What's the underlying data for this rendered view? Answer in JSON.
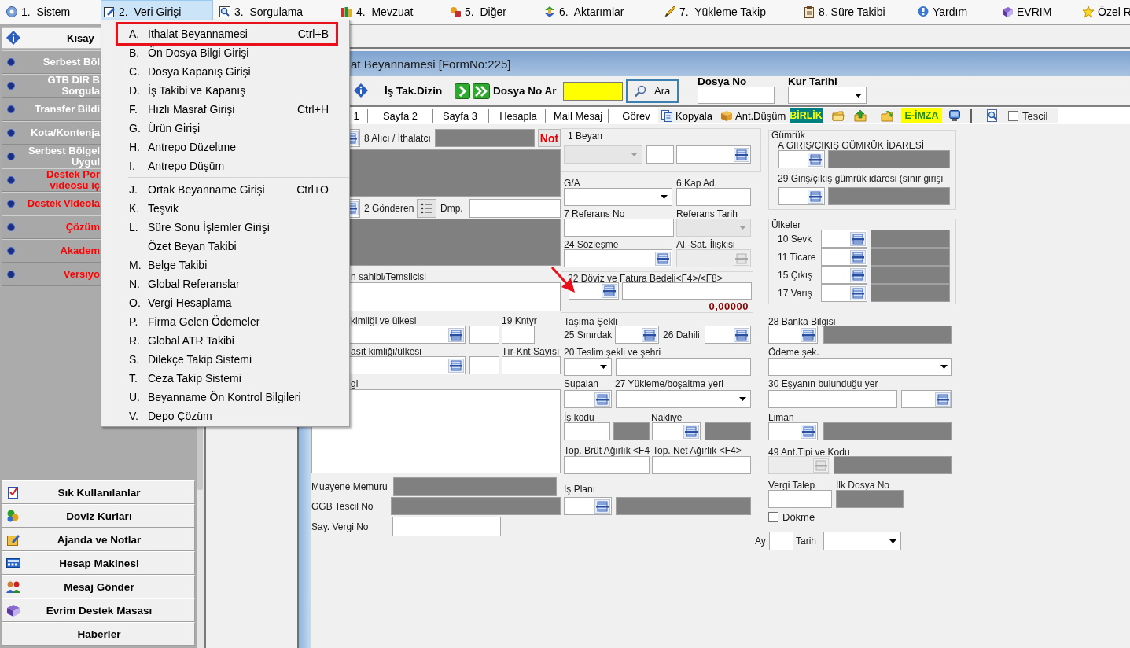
{
  "menu_bar": [
    {
      "label": "1.  Sistem",
      "selected": false
    },
    {
      "label": "2.  Veri Girişi",
      "selected": true
    },
    {
      "label": "3.  Sorgulama",
      "selected": false
    },
    {
      "label": "4.  Mevzuat",
      "selected": false
    },
    {
      "label": "5.  Diğer",
      "selected": false
    },
    {
      "label": "6.  Aktarımlar",
      "selected": false
    },
    {
      "label": "7.  Yükleme Takip",
      "selected": false
    },
    {
      "label": "8. Süre Takibi",
      "selected": false
    },
    {
      "label": "Yardım",
      "selected": false
    },
    {
      "label": "EVRIM",
      "selected": false
    },
    {
      "label": "Özel R",
      "selected": false
    }
  ],
  "dropdown": [
    {
      "kind": "item",
      "key": "A.",
      "label": "İthalat Beyannamesi",
      "shortcut": "Ctrl+B",
      "selected": true
    },
    {
      "kind": "item",
      "key": "B.",
      "label": "Ön Dosya Bilgi Girişi",
      "selected": false
    },
    {
      "kind": "item",
      "key": "C.",
      "label": "Dosya Kapanış Girişi",
      "selected": false
    },
    {
      "kind": "item",
      "key": "D.",
      "label": "İş Takibi ve Kapanış",
      "selected": false
    },
    {
      "kind": "item",
      "key": "F.",
      "label": "Hızlı Masraf Girişi",
      "shortcut": "Ctrl+H",
      "selected": false
    },
    {
      "kind": "item",
      "key": "G.",
      "label": "Ürün Girişi",
      "selected": false
    },
    {
      "kind": "item",
      "key": "H.",
      "label": "Antrepo Düzeltme",
      "selected": false
    },
    {
      "kind": "item",
      "key": "I.",
      "label": "Antrepo Düşüm",
      "selected": false
    },
    {
      "kind": "separator"
    },
    {
      "kind": "item",
      "key": "J.",
      "label": "Ortak Beyanname Girişi",
      "shortcut": "Ctrl+O",
      "selected": false
    },
    {
      "kind": "item",
      "key": "K.",
      "label": "Teşvik",
      "selected": false
    },
    {
      "kind": "item",
      "key": "L.",
      "label": "Süre Sonu İşlemler Girişi",
      "selected": false
    },
    {
      "kind": "item",
      "label": "Özet Beyan Takibi",
      "selected": false
    },
    {
      "kind": "item",
      "key": "M.",
      "label": "Belge Takibi",
      "selected": false
    },
    {
      "kind": "item",
      "key": "N.",
      "label": "Global Referanslar",
      "selected": false
    },
    {
      "kind": "item",
      "key": "O.",
      "label": "Vergi Hesaplama",
      "selected": false
    },
    {
      "kind": "item",
      "key": "P.",
      "label": "Firma Gelen Ödemeler",
      "selected": false
    },
    {
      "kind": "item",
      "key": "R.",
      "label": "Global ATR Takibi",
      "selected": false
    },
    {
      "kind": "item",
      "key": "S.",
      "label": "Dilekçe Takip Sistemi",
      "selected": false
    },
    {
      "kind": "item",
      "key": "T.",
      "label": "Ceza Takip Sistemi",
      "selected": false
    },
    {
      "kind": "item",
      "key": "U.",
      "label": "Beyanname Ön Kontrol Bilgileri",
      "selected": false
    },
    {
      "kind": "item",
      "key": "V.",
      "label": "Depo Çözüm",
      "selected": false
    }
  ],
  "sidebar": {
    "header": "Kısay",
    "items": [
      {
        "label": "Serbest Böl",
        "color": "#ffffff"
      },
      {
        "label": "GTB DIR B\nSorgula",
        "color": "#ffffff"
      },
      {
        "label": "Transfer Bildi",
        "color": "#ffffff"
      },
      {
        "label": "Kota/Kontenja",
        "color": "#ffffff"
      },
      {
        "label": "Serbest Bölgel\nUygul",
        "color": "#ffffff"
      },
      {
        "label": "Destek Por\nvideosu iç",
        "color": "#ff0000"
      },
      {
        "label": "Destek Videola",
        "color": "#ff0000"
      },
      {
        "label": "Çözüm",
        "color": "#ff0000"
      },
      {
        "label": "Akadem",
        "color": "#ff0000"
      },
      {
        "label": "Versiyo",
        "color": "#ff0000"
      }
    ],
    "buttons": [
      "Sık Kullanılanlar",
      "Doviz Kurları",
      "Ajanda ve Notlar",
      "Hesap Makinesi",
      "Mesaj Gönder",
      "Evrim Destek Masası",
      "Haberler"
    ]
  },
  "form": {
    "title": "at Beyannamesi [FormNo:225]",
    "search_bar": {
      "folder_label": "İş Tak.Dizin",
      "search_label": "Dosya No Ar",
      "search_button": "Ara",
      "file_no_label": "Dosya No",
      "rate_date_label": "Kur Tarihi"
    },
    "tabs": [
      "1",
      "Sayfa 2",
      "Sayfa 3",
      "Hesapla",
      "Mail Mesaj",
      "Görev"
    ],
    "tools": [
      {
        "kind": "copy",
        "label": "Kopyala"
      },
      {
        "kind": "box",
        "label": "Ant.Düşüm"
      },
      {
        "kind": "badge",
        "label": "BİRLİK",
        "color": "#008080"
      },
      {
        "kind": "folder"
      },
      {
        "kind": "upload"
      },
      {
        "kind": "move"
      },
      {
        "kind": "badge",
        "label": "E-İMZA",
        "color": "#ffff00"
      },
      {
        "kind": "monitor"
      },
      {
        "kind": "divider"
      },
      {
        "kind": "preview"
      },
      {
        "kind": "checkbox",
        "label": "Tescil",
        "checked": false
      }
    ],
    "columns": [
      [
        [
          {
            "kind": "lookup",
            "disabled": false
          },
          {
            "kind": "label",
            "text": "8 Alıcı / İthalatcı"
          },
          {
            "kind": "shaded"
          },
          {
            "kind": "button",
            "text": "Not"
          }
        ],
        [
          {
            "kind": "shaded"
          }
        ],
        [
          {
            "kind": "lookup",
            "disabled": false
          },
          {
            "kind": "label",
            "text": "2 Gönderen"
          },
          {
            "kind": "list"
          },
          {
            "kind": "label",
            "text": "Dmp."
          },
          {
            "kind": "input",
            "disabled": false
          }
        ],
        [
          {
            "kind": "shaded"
          }
        ],
        [
          {
            "kind": "label",
            "text": "n sahibi/Temsilcisi"
          }
        ],
        [
          {
            "kind": "memo"
          }
        ],
        [
          {
            "kind": "label",
            "text": "kimliği ve ülkesi"
          },
          {
            "kind": "label",
            "text": "19 Kntyr"
          }
        ],
        [
          {
            "kind": "lookup",
            "disabled": false
          },
          {
            "kind": "input",
            "disabled": false
          },
          {
            "kind": "input",
            "disabled": false
          }
        ],
        [
          {
            "kind": "label",
            "text": "aşıt kimliği/ülkesi"
          },
          {
            "kind": "label",
            "text": "Tır-Knt Sayısı"
          }
        ],
        [
          {
            "kind": "lookup",
            "disabled": false
          },
          {
            "kind": "input",
            "disabled": false
          },
          {
            "kind": "input",
            "disabled": false
          }
        ],
        [
          {
            "kind": "label",
            "text": "gi"
          }
        ],
        [
          {
            "kind": "memo"
          }
        ],
        [
          {
            "kind": "label",
            "text": "Muayene Memuru"
          },
          {
            "kind": "shaded"
          }
        ],
        [
          {
            "kind": "label",
            "text": "GGB Tescil No"
          },
          {
            "kind": "shaded"
          }
        ],
        [
          {
            "kind": "label",
            "text": "Say. Vergi No"
          },
          {
            "kind": "input",
            "disabled": false
          }
        ]
      ],
      [
        [
          {
            "kind": "group",
            "legend": "1 Beyan",
            "rows": [
              [
                {
                  "kind": "dropdown",
                  "disabled": true
                },
                {
                  "kind": "input",
                  "disabled": false
                },
                {
                  "kind": "lookup",
                  "disabled": false
                }
              ]
            ]
          }
        ],
        [
          {
            "kind": "label",
            "text": "G/A"
          },
          {
            "kind": "label",
            "text": "6 Kap Ad."
          }
        ],
        [
          {
            "kind": "dropdown",
            "disabled": false
          },
          {
            "kind": "input",
            "disabled": false
          }
        ],
        [
          {
            "kind": "label",
            "text": "7 Referans No"
          },
          {
            "kind": "label",
            "text": "Referans Tarih"
          }
        ],
        [
          {
            "kind": "input",
            "disabled": false
          },
          {
            "kind": "dropdown",
            "disabled": true
          }
        ],
        [
          {
            "kind": "label",
            "text": "24 Sözleşme"
          },
          {
            "kind": "label",
            "text": "Al.-Sat. İlişkisi"
          }
        ],
        [
          {
            "kind": "lookup",
            "disabled": false
          },
          {
            "kind": "lookup",
            "disabled": true
          }
        ],
        [
          {
            "kind": "group",
            "legend": "22 Döviz ve Fatura Bedeli<F4>/<F8>",
            "rows": [
              [
                {
                  "kind": "lookup",
                  "disabled": false
                },
                {
                  "kind": "input",
                  "disabled": false
                }
              ],
              [
                {
                  "kind": "value",
                  "text": "0,00000"
                }
              ]
            ]
          }
        ],
        [
          {
            "kind": "label",
            "text": "Taşıma Şekli"
          }
        ],
        [
          {
            "kind": "label",
            "text": "25 Sınırdak"
          },
          {
            "kind": "lookup",
            "disabled": false
          },
          {
            "kind": "label",
            "text": "26 Dahili"
          },
          {
            "kind": "lookup",
            "disabled": false
          }
        ],
        [
          {
            "kind": "label",
            "text": "20 Teslim şekli ve şehri"
          }
        ],
        [
          {
            "kind": "dropdown",
            "disabled": false
          },
          {
            "kind": "input",
            "disabled": false
          }
        ],
        [
          {
            "kind": "label",
            "text": "Supalan"
          },
          {
            "kind": "label",
            "text": "27 Yükleme/boşaltma yeri"
          }
        ],
        [
          {
            "kind": "lookup",
            "disabled": false
          },
          {
            "kind": "dropdown",
            "disabled": false
          }
        ],
        [
          {
            "kind": "label",
            "text": "İş kodu"
          },
          {
            "kind": "label",
            "text": "Nakliye"
          }
        ],
        [
          {
            "kind": "input",
            "disabled": false
          },
          {
            "kind": "shaded"
          },
          {
            "kind": "lookup",
            "disabled": false
          },
          {
            "kind": "shaded"
          }
        ],
        [
          {
            "kind": "label",
            "text": "Top. Brüt Ağırlık <F4"
          },
          {
            "kind": "label",
            "text": "Top. Net Ağırlık <F4>"
          }
        ],
        [
          {
            "kind": "input",
            "disabled": false
          },
          {
            "kind": "input",
            "disabled": false
          }
        ],
        [
          {
            "kind": "label",
            "text": "İş Planı"
          }
        ],
        [
          {
            "kind": "lookup",
            "disabled": false
          },
          {
            "kind": "shaded"
          }
        ]
      ],
      [
        [
          {
            "kind": "group",
            "legend": "Gümrük",
            "rows": [
              [
                {
                  "kind": "label",
                  "text": "A GIRIŞ/ÇIKIŞ GÜMRÜK İDARESİ"
                }
              ],
              [
                {
                  "kind": "lookup",
                  "disabled": false
                },
                {
                  "kind": "shaded"
                }
              ],
              [
                {
                  "kind": "label",
                  "text": "29 Giriş/çıkış gümrük idaresi (sınır girişi"
                }
              ],
              [
                {
                  "kind": "lookup",
                  "disabled": false
                },
                {
                  "kind": "shaded"
                }
              ]
            ]
          }
        ],
        [
          {
            "kind": "group",
            "legend": "Ülkeler",
            "rows": [
              [
                {
                  "kind": "label",
                  "text": "10 Sevk"
                },
                {
                  "kind": "lookup",
                  "disabled": false
                },
                {
                  "kind": "shaded"
                }
              ],
              [
                {
                  "kind": "label",
                  "text": "11 Ticare"
                },
                {
                  "kind": "lookup",
                  "disabled": false
                },
                {
                  "kind": "shaded"
                }
              ],
              [
                {
                  "kind": "label",
                  "text": "15 Çıkış"
                },
                {
                  "kind": "lookup",
                  "disabled": false
                },
                {
                  "kind": "shaded"
                }
              ],
              [
                {
                  "kind": "label",
                  "text": "17 Varış"
                },
                {
                  "kind": "lookup",
                  "disabled": false
                },
                {
                  "kind": "shaded"
                }
              ]
            ]
          }
        ],
        [
          {
            "kind": "label",
            "text": "28 Banka Bilgisi"
          }
        ],
        [
          {
            "kind": "lookup",
            "disabled": false
          },
          {
            "kind": "shaded"
          }
        ],
        [
          {
            "kind": "label",
            "text": "Ödeme şek."
          }
        ],
        [
          {
            "kind": "dropdown",
            "disabled": false
          }
        ],
        [
          {
            "kind": "label",
            "text": "30 Eşyanın bulunduğu yer"
          }
        ],
        [
          {
            "kind": "input",
            "disabled": false
          },
          {
            "kind": "lookup",
            "disabled": false
          }
        ],
        [
          {
            "kind": "label",
            "text": "Liman"
          }
        ],
        [
          {
            "kind": "lookup",
            "disabled": false
          },
          {
            "kind": "shaded"
          }
        ],
        [
          {
            "kind": "label",
            "text": "49 Ant.Tipi ve Kodu"
          }
        ],
        [
          {
            "kind": "lookup",
            "disabled": true
          },
          {
            "kind": "shaded"
          }
        ],
        [
          {
            "kind": "label",
            "text": "Vergi Talep"
          },
          {
            "kind": "label",
            "text": "İlk Dosya No"
          }
        ],
        [
          {
            "kind": "input",
            "disabled": false
          },
          {
            "kind": "shaded"
          }
        ],
        [
          {
            "kind": "checkbox",
            "text": "Dökme",
            "checked": false
          }
        ],
        [
          {
            "kind": "label",
            "text": "Ay"
          },
          {
            "kind": "input",
            "disabled": false
          },
          {
            "kind": "label",
            "text": "Tarih"
          },
          {
            "kind": "dropdown",
            "disabled": false
          }
        ]
      ]
    ]
  }
}
